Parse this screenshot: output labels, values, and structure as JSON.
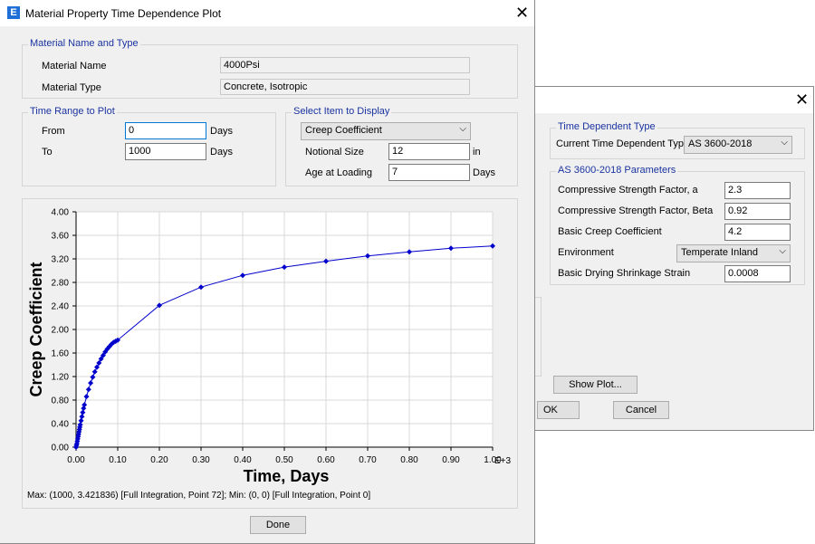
{
  "main": {
    "title": "Material Property Time Dependence Plot",
    "app_icon_letter": "E",
    "material_group": {
      "legend": "Material Name and Type",
      "name_label": "Material Name",
      "name_value": "4000Psi",
      "type_label": "Material Type",
      "type_value": "Concrete, Isotropic"
    },
    "time_range": {
      "legend": "Time Range to Plot",
      "from_label": "From",
      "from_value": "0",
      "from_unit": "Days",
      "to_label": "To",
      "to_value": "1000",
      "to_unit": "Days"
    },
    "select_item": {
      "legend": "Select Item to Display",
      "item_value": "Creep Coefficient",
      "notional_label": "Notional Size",
      "notional_value": "12",
      "notional_unit": "in",
      "age_label": "Age at Loading",
      "age_value": "7",
      "age_unit": "Days"
    },
    "status_line": "Max: (1000, 3.421836)   [Full Integration, Point 72];   Min: (0, 0)   [Full Integration, Point 0]",
    "done_label": "Done"
  },
  "side": {
    "time_dep_group": {
      "legend": "Time Dependent Type",
      "current_label": "Current Time Dependent Type",
      "current_value": "AS 3600-2018"
    },
    "params_group": {
      "legend": "AS 3600-2018 Parameters",
      "rows": [
        {
          "label": "Compressive Strength Factor, a",
          "value": "2.3"
        },
        {
          "label": "Compressive Strength Factor, Beta",
          "value": "0.92"
        },
        {
          "label": "Basic Creep Coefficient",
          "value": "4.2"
        },
        {
          "label": "Environment",
          "value": "Temperate Inland"
        },
        {
          "label": "Basic Drying Shrinkage Strain",
          "value": "0.0008"
        }
      ]
    },
    "show_plot_label": "Show Plot...",
    "ok_label": "OK",
    "cancel_label": "Cancel"
  },
  "chart_data": {
    "type": "line",
    "xlabel": "Time, Days",
    "ylabel": "Creep Coefficient",
    "x_multiplier_label": "E+3",
    "xlim": [
      0,
      1.0
    ],
    "ylim": [
      0,
      4.0
    ],
    "x_ticks": [
      "0.00",
      "0.10",
      "0.20",
      "0.30",
      "0.40",
      "0.50",
      "0.60",
      "0.70",
      "0.80",
      "0.90",
      "1.00"
    ],
    "y_ticks": [
      "0.00",
      "0.40",
      "0.80",
      "1.20",
      "1.60",
      "2.00",
      "2.40",
      "2.80",
      "3.20",
      "3.60",
      "4.00"
    ],
    "grid": true,
    "series_color": "#0000cc",
    "x": [
      0,
      0.001,
      0.002,
      0.003,
      0.004,
      0.005,
      0.006,
      0.007,
      0.008,
      0.009,
      0.01,
      0.012,
      0.014,
      0.016,
      0.018,
      0.02,
      0.025,
      0.03,
      0.035,
      0.04,
      0.045,
      0.05,
      0.055,
      0.06,
      0.065,
      0.07,
      0.075,
      0.08,
      0.085,
      0.09,
      0.095,
      0.1,
      0.2,
      0.3,
      0.4,
      0.5,
      0.6,
      0.7,
      0.8,
      0.9,
      1.0
    ],
    "y": [
      0,
      0.03,
      0.06,
      0.1,
      0.14,
      0.18,
      0.22,
      0.26,
      0.3,
      0.34,
      0.38,
      0.45,
      0.52,
      0.59,
      0.66,
      0.72,
      0.86,
      0.98,
      1.09,
      1.19,
      1.28,
      1.36,
      1.43,
      1.5,
      1.56,
      1.62,
      1.67,
      1.71,
      1.75,
      1.78,
      1.8,
      1.82,
      2.41,
      2.72,
      2.92,
      3.06,
      3.16,
      3.25,
      3.32,
      3.38,
      3.42
    ]
  }
}
